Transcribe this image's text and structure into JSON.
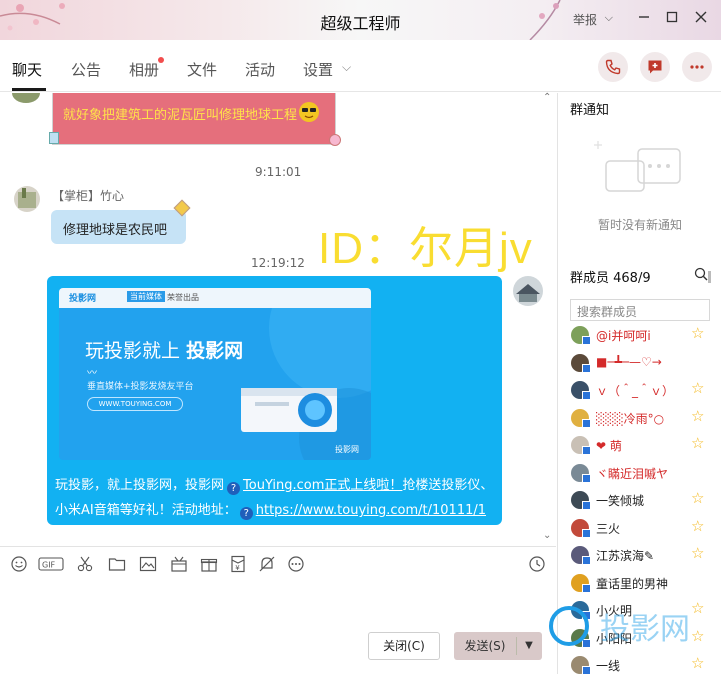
{
  "window": {
    "title": "超级工程师",
    "report_label": "举报"
  },
  "tabs": [
    {
      "label": "聊天",
      "active": true
    },
    {
      "label": "公告",
      "active": false
    },
    {
      "label": "相册",
      "active": false,
      "has_dot": true
    },
    {
      "label": "文件",
      "active": false
    },
    {
      "label": "活动",
      "active": false
    },
    {
      "label": "设置",
      "active": false,
      "has_dropdown": true
    }
  ],
  "header_actions": [
    "phone-icon",
    "message-plus-icon",
    "more-icon"
  ],
  "chat": {
    "pink_message": "就好象把建筑工的泥瓦匠叫修理地球工程",
    "time1": "9:11:01",
    "sender_name": "【掌柜】竹心",
    "bubble_text": "修理地球是农民吧",
    "time2": "12:19:12",
    "banner": {
      "brand": "投影网",
      "badge1": "当前媒体",
      "badge2": "荣誉出品",
      "headline_light": "玩投影就上",
      "headline_bold": "投影网",
      "tagline": "垂直媒体+投影发烧友平台",
      "url": "WWW.TOUYING.COM",
      "corner": "投影网"
    },
    "line1_a": "玩投影，就上投影网，投影网",
    "line1_link": "TouYing.com正式上线啦！",
    "line1_b": "抢楼送投影仪、",
    "line2_a": "小米AI音箱等好礼！活动地址：",
    "line2_link": "https://www.touying.com/t/10111/1"
  },
  "overlay_watermark": "ID：尔月jv",
  "toolbar_icons": [
    "emoji-icon",
    "gif-icon",
    "scissors-icon",
    "folder-icon",
    "image-icon",
    "gift-box-icon",
    "gift-icon",
    "red-packet-icon",
    "mute-bell-icon",
    "more-icon",
    "history-clock-icon"
  ],
  "buttons": {
    "close": "关闭(C)",
    "send": "发送(S)"
  },
  "sidebar": {
    "notice_title": "群通知",
    "notice_empty": "暂时没有新通知",
    "members_title": "群成员 468/9",
    "search_placeholder": "搜索群成员",
    "members": [
      {
        "name": "@i并呵呵i",
        "color": "#d42a2a",
        "star": true
      },
      {
        "name": "■─┻─—♡→",
        "color": "#d42a2a",
        "star": false
      },
      {
        "name": "ｖ（＾_＾ｖ）",
        "color": "#d42a2a",
        "star": true
      },
      {
        "name": "░░░冷雨°○",
        "color": "#d42a2a",
        "star": true
      },
      {
        "name": "❤ 萌",
        "color": "#d42a2a",
        "star": true
      },
      {
        "name": "ヾ瞞近泪嘁ヤ",
        "color": "#d42a2a",
        "star": false
      },
      {
        "name": "一笑倾城",
        "color": "#222222",
        "star": true
      },
      {
        "name": "三火",
        "color": "#222222",
        "star": true
      },
      {
        "name": "江苏滨海✎",
        "color": "#222222",
        "star": true
      },
      {
        "name": "童话里的男神",
        "color": "#222222",
        "star": false
      },
      {
        "name": "小火明",
        "color": "#222222",
        "star": true
      },
      {
        "name": "小阳阳",
        "color": "#222222",
        "star": true
      },
      {
        "name": "一线",
        "color": "#222222",
        "star": true
      }
    ]
  },
  "corner_watermark": "投影网"
}
